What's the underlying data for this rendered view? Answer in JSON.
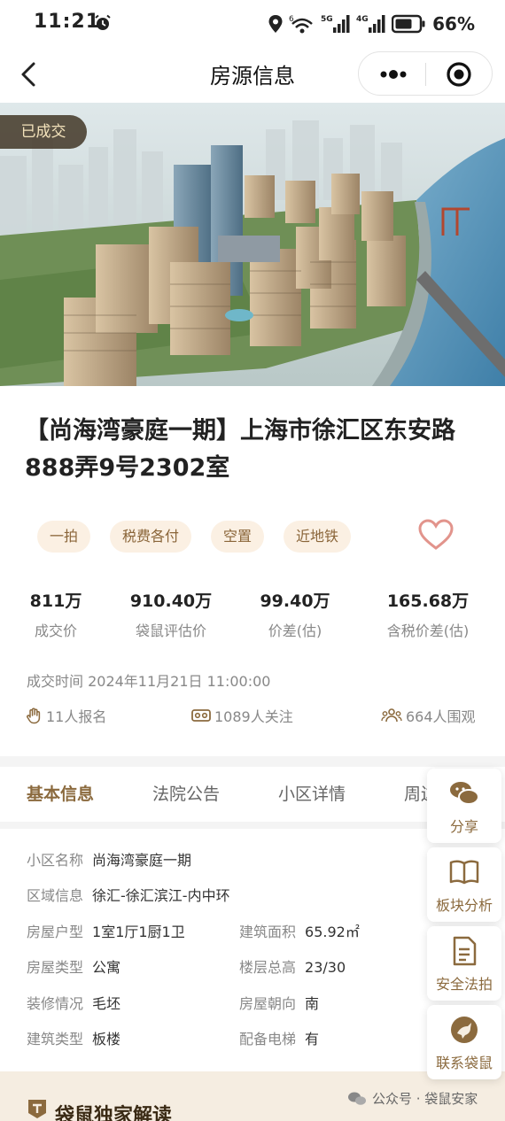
{
  "status_bar": {
    "time": "11:21",
    "battery": "66%",
    "network_labels": [
      "6",
      "5G",
      "4G"
    ]
  },
  "nav": {
    "title": "房源信息",
    "icons": [
      "back-icon",
      "more-icon",
      "target-icon"
    ]
  },
  "hero": {
    "badge": "已成交"
  },
  "property": {
    "title": "【尚海湾豪庭一期】上海市徐汇区东安路888弄9号2302室",
    "tags": [
      "一拍",
      "税费各付",
      "空置",
      "近地铁"
    ],
    "stats": [
      {
        "value": "811万",
        "label": "成交价"
      },
      {
        "value": "910.40万",
        "label": "袋鼠评估价"
      },
      {
        "value": "99.40万",
        "label": "价差(估)"
      },
      {
        "value": "165.68万",
        "label": "含税价差(估)"
      }
    ],
    "deal_time": "成交时间 2024年11月21日 11:00:00",
    "meta": {
      "signups": "11人报名",
      "follows": "1089人关注",
      "views": "664人围观"
    }
  },
  "tabs": [
    "基本信息",
    "法院公告",
    "小区详情",
    "周边"
  ],
  "details": {
    "community": {
      "label": "小区名称",
      "value": "尚海湾豪庭一期"
    },
    "region": {
      "label": "区域信息",
      "value": "徐汇-徐汇滨江-内中环"
    },
    "rows": [
      {
        "l1": "房屋户型",
        "v1": "1室1厅1厨1卫",
        "l2": "建筑面积",
        "v2": "65.92㎡"
      },
      {
        "l1": "房屋类型",
        "v1": "公寓",
        "l2": "楼层总高",
        "v2": "23/30"
      },
      {
        "l1": "装修情况",
        "v1": "毛坯",
        "l2": "房屋朝向",
        "v2": "南"
      },
      {
        "l1": "建筑类型",
        "v1": "板楼",
        "l2": "配备电梯",
        "v2": "有"
      }
    ]
  },
  "exclusive": {
    "title": "袋鼠独家解读",
    "watermark": "公众号 · 袋鼠安家"
  },
  "fab": [
    {
      "label": "分享",
      "icon": "share-chat-icon"
    },
    {
      "label": "板块分析",
      "icon": "book-icon"
    },
    {
      "label": "安全法拍",
      "icon": "document-icon"
    },
    {
      "label": "联系袋鼠",
      "icon": "kangaroo-icon"
    }
  ],
  "colors": {
    "accent": "#8b6a3e",
    "tag_bg": "#fbf0e3",
    "banner_bg": "#f5ede1",
    "heart": "#e2948c"
  }
}
